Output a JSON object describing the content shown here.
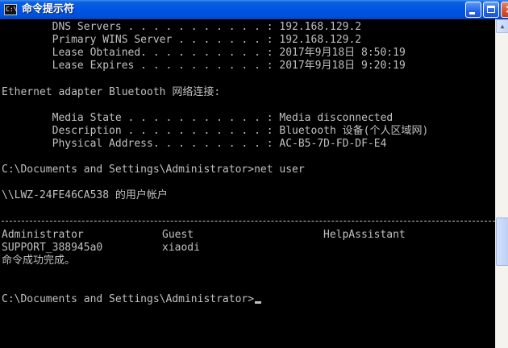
{
  "window": {
    "title": "命令提示符",
    "app_icon_glyph": "C:\\",
    "close_glyph": "×"
  },
  "console": {
    "lines": [
      "        DNS Servers . . . . . . . . . . . : 192.168.129.2",
      "        Primary WINS Server . . . . . . . : 192.168.129.2",
      "        Lease Obtained. . . . . . . . . . : 2017年9月18日 8:50:19",
      "        Lease Expires . . . . . . . . . . : 2017年9月18日 9:20:19",
      "Ethernet adapter Bluetooth 网络连接:",
      "        Media State . . . . . . . . . . . : Media disconnected",
      "        Description . . . . . . . . . . . : Bluetooth 设备(个人区域网)",
      "        Physical Address. . . . . . . . . : AC-B5-7D-FD-DF-E4",
      "C:\\Documents and Settings\\Administrator>net user",
      "\\\\LWZ-24FE46CA538 的用户帐户",
      "命令成功完成。",
      "C:\\Documents and Settings\\Administrator>"
    ],
    "user_table": {
      "rows": [
        [
          "Administrator",
          "Guest",
          "HelpAssistant"
        ],
        [
          "SUPPORT_388945a0",
          "xiaodi",
          ""
        ]
      ]
    }
  },
  "colors": {
    "console_background": "#000000",
    "console_text": "#c0c0c0",
    "titlebar": "#0054e3"
  },
  "icons": {
    "app": "cmd-icon",
    "minimize": "minimize-icon",
    "maximize": "maximize-icon",
    "close": "close-icon"
  }
}
